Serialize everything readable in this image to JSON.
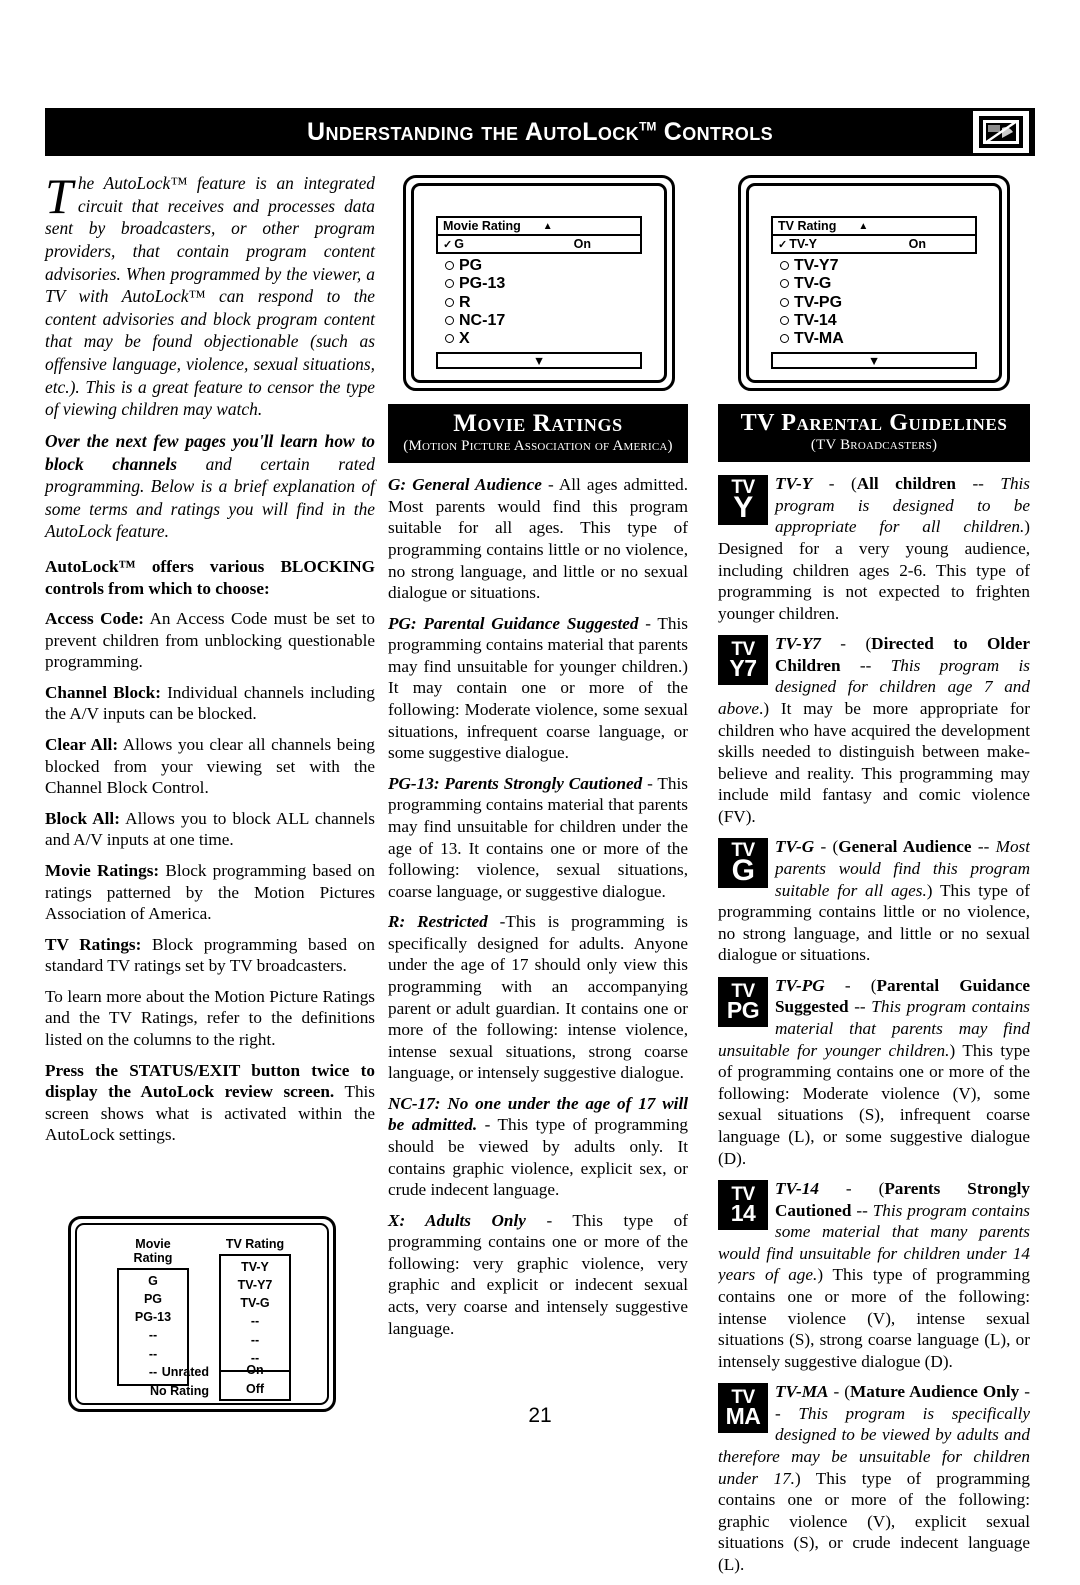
{
  "header": {
    "title_pre": "Understanding the ",
    "title_brand": "AutoLock",
    "title_tm": "TM",
    "title_post": " Controls",
    "logo_icon": "tv-blocked-icon"
  },
  "page_number": "21",
  "left_column": {
    "intro": [
      "The AutoLock™ feature is an integrated circuit that receives and processes data sent by broadcasters, or other program providers, that contain program content advisories. When programmed by the viewer, a TV with AutoLock™ can respond to the content advisories and block program content that may be found objectionable (such as offensive language, violence, sexual situations, etc.). This is a great feature to censor the type of viewing children may watch."
    ],
    "intro2_bold": "Over the next few pages you'll learn how to block channels",
    "intro2_rest": " and certain rated programming. Below is a brief explanation of some terms and ratings you will find in the AutoLock feature.",
    "blocking_heading": "AutoLock™ offers various BLOCKING controls from which to choose:",
    "items": [
      {
        "term": "Access Code:",
        "text": " An Access Code must be set to prevent children from unblocking questionable programming."
      },
      {
        "term": "Channel Block:",
        "text": " Individual channels including the A/V inputs can be blocked."
      },
      {
        "term": "Clear All:",
        "text": " Allows you clear all channels being blocked from your viewing set with the Channel Block Control."
      },
      {
        "term": "Block All:",
        "text": " Allows you to block ALL channels and A/V inputs at one time."
      },
      {
        "term": "Movie Ratings:",
        "text": " Block programming based on ratings patterned by the Motion Pictures Association of America."
      },
      {
        "term": "TV Ratings:",
        "text": " Block programming based on standard TV ratings set by TV broadcasters."
      }
    ],
    "learn_more": "To learn more about the Motion Picture Ratings and the TV Ratings, refer to the definitions listed on the columns to the right.",
    "status_bold": "Press the STATUS/EXIT button twice to display the AutoLock review screen.",
    "status_rest": " This screen shows what is activated within the AutoLock settings."
  },
  "osd_movie": {
    "header_label": "Movie Rating",
    "up_arrow": "▲",
    "selected_check": "✓",
    "selected_label": "G",
    "selected_value": "On",
    "options": [
      "PG",
      "PG-13",
      "R",
      "NC-17",
      "X"
    ],
    "down_arrow": "▼"
  },
  "osd_tv": {
    "header_label": "TV Rating",
    "up_arrow": "▲",
    "selected_check": "✓",
    "selected_label": "TV-Y",
    "selected_value": "On",
    "options": [
      "TV-Y7",
      "TV-G",
      "TV-PG",
      "TV-14",
      "TV-MA"
    ],
    "down_arrow": "▼"
  },
  "review_screen": {
    "movie_title": "Movie Rating",
    "movie_rows": [
      "G",
      "PG",
      "PG-13",
      "--",
      "--",
      "--"
    ],
    "tv_title": "TV Rating",
    "tv_rows": [
      "TV-Y",
      "TV-Y7",
      "TV-G",
      "--",
      "--",
      "--"
    ],
    "unrated_label": "Unrated",
    "unrated_value": "On",
    "norating_label": "No Rating",
    "norating_value": "Off"
  },
  "movie_ratings": {
    "title": "Movie Ratings",
    "subtitle": "(Motion Picture Association of America)",
    "entries": [
      {
        "term": "G: General Audience",
        "body": " - All ages admitted. Most parents would find this program suitable for all ages. This type of programming contains little or no violence, no strong language, and little or no sexual dialogue or situations."
      },
      {
        "term": "PG: Parental Guidance Suggested",
        "body": " - This programming contains material that parents may find unsuitable for younger children.) It may contain one or more of the following: Moderate violence, some sexual situations, infrequent coarse language, or some suggestive dialogue."
      },
      {
        "term": "PG-13: Parents Strongly Cautioned",
        "body": " - This programming contains material that parents may find unsuitable for children under the age of 13. It contains one or more of the following: violence, sexual situations, coarse language, or suggestive dialogue."
      },
      {
        "term": "R: Restricted",
        "body": " -This is programming is specifically designed for adults.  Anyone under the age of 17 should only view this programming with an accompanying parent or adult guardian. It contains one or more of the following: intense violence, intense sexual situations, strong coarse language, or intensely suggestive dialogue."
      },
      {
        "term": "NC-17: No one under the age of 17 will be admitted.",
        "body": " - This type of programming should be viewed by adults only. It contains graphic violence, explicit sex, or crude indecent language."
      },
      {
        "term": "X: Adults Only",
        "body": " - This type of programming contains one or more of the following: very graphic violence, very graphic and explicit or indecent sexual acts, very coarse and intensely suggestive language."
      }
    ]
  },
  "tv_guidelines": {
    "title": "TV Parental Guidelines",
    "subtitle": "(TV Broadcasters)",
    "entries": [
      {
        "icon_name": "tv-y-icon",
        "icon_row1": "TV",
        "icon_row2": "Y",
        "icon_single": true,
        "term": "TV-Y",
        "paren_bold": "All children",
        "paren_italic": " -- This program is designed to be appropriate for all children.",
        "body": ") Designed for a very young audience, including children ages 2-6. This type of programming is not expected to frighten younger children."
      },
      {
        "icon_name": "tv-y7-icon",
        "icon_row1": "TV",
        "icon_row2": "Y7",
        "icon_single": false,
        "term": "TV-Y7",
        "paren_bold": "Directed to Older Children",
        "paren_italic": " -- This program is designed for children age 7 and above",
        "body": ".) It may be more appropriate for children who have acquired the development skills needed to distinguish between make-believe and reality. This programming may include mild fantasy and comic violence (FV)."
      },
      {
        "icon_name": "tv-g-icon",
        "icon_row1": "TV",
        "icon_row2": "G",
        "icon_single": true,
        "term": "TV-G",
        "paren_bold": "General Audience",
        "paren_italic": " -- Most parents would find this program suitable for all ages.",
        "body": ") This type of programming contains little or no violence, no strong language, and little or no sexual dialogue or situations."
      },
      {
        "icon_name": "tv-pg-icon",
        "icon_row1": "TV",
        "icon_row2": "PG",
        "icon_single": false,
        "term": "TV-PG",
        "paren_bold": "Parental Guidance Suggested",
        "paren_italic": " -- This program contains material that parents may find unsuitable for younger children.",
        "body": ") This type of programming contains one or more of the following: Moderate violence (V), some sexual situations (S), infrequent coarse language (L), or some suggestive dialogue (D)."
      },
      {
        "icon_name": "tv-14-icon",
        "icon_row1": "TV",
        "icon_row2": "14",
        "icon_single": false,
        "term": "TV-14",
        "paren_bold": "Parents Strongly Cautioned",
        "paren_italic": " -- This program contains some material that many parents would find unsuitable for children under 14 years of age.",
        "body": ") This type of programming contains one or more of the following: intense violence (V), intense sexual situations (S), strong coarse language (L), or intensely suggestive dialogue (D)."
      },
      {
        "icon_name": "tv-ma-icon",
        "icon_row1": "TV",
        "icon_row2": "MA",
        "icon_single": false,
        "term": "TV-MA",
        "paren_bold": "Mature Audience Only",
        "paren_italic": " -- This program is specifically designed to be viewed by adults and therefore may be unsuitable for children under 17.",
        "body": ") This type of programming contains one or more of the following: graphic violence (V), explicit sexual situations (S), or crude indecent language (L)."
      }
    ]
  }
}
